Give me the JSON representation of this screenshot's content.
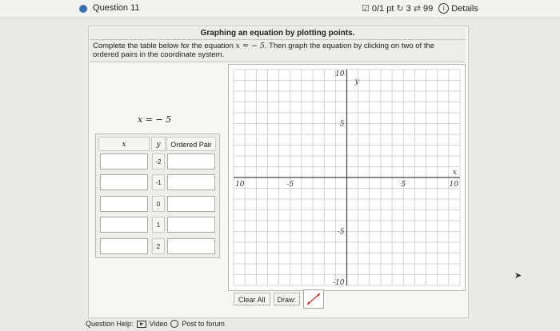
{
  "header": {
    "question_title": "Question 11",
    "score": "0/1 pt",
    "attempts": "3",
    "remaining": "99",
    "details_label": "Details"
  },
  "problem": {
    "title": "Graphing an equation by plotting points.",
    "instruction_line1_pre": "Complete the table below for the equation ",
    "instruction_eq": "x = − 5",
    "instruction_line1_post": ". Then graph the equation by clicking on two of the",
    "instruction_line2": "ordered pairs in the coordinate system.",
    "equation": "x = − 5"
  },
  "table": {
    "header_x": "x",
    "header_y": "y",
    "header_pair": "Ordered Pair",
    "rows": [
      {
        "y": "-2"
      },
      {
        "y": "-1"
      },
      {
        "y": "0"
      },
      {
        "y": "1"
      },
      {
        "y": "2"
      }
    ]
  },
  "graph": {
    "x_min": -10,
    "x_max": 10,
    "y_min": -10,
    "y_max": 10,
    "labels": {
      "y_axis": "y",
      "x_axis": "x",
      "top": "10",
      "bottom": "-10",
      "left": "10",
      "right": "10",
      "neg5x": "-5",
      "pos5x": "5",
      "pos5y": "5",
      "neg5y": "-5"
    }
  },
  "toolbar": {
    "clear_all": "Clear All",
    "draw": "Draw:"
  },
  "help": {
    "label": "Question Help:",
    "video": "Video",
    "post": "Post to forum"
  },
  "colors": {
    "accent": "#3a6fb0",
    "grid": "#c8c8c8",
    "axis": "#444444",
    "draw_line": "#c0392b"
  }
}
